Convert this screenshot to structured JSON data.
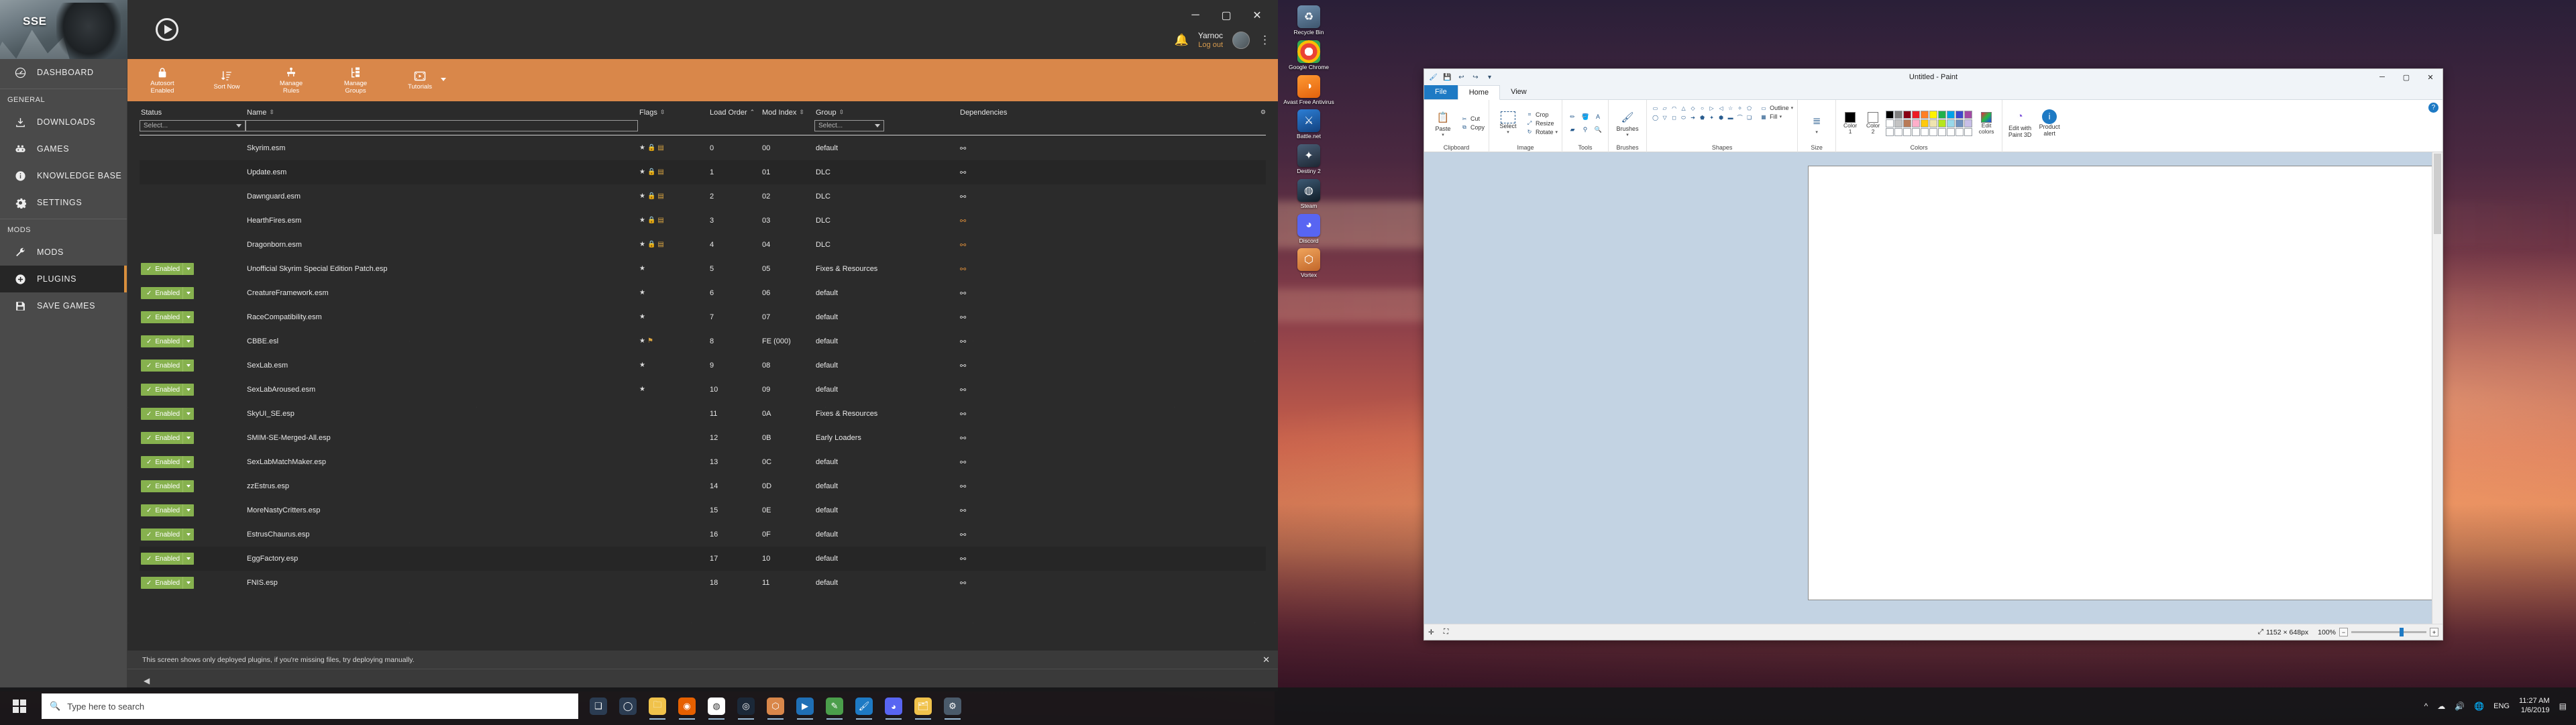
{
  "desktop": {
    "icons": [
      {
        "name": "Recycle Bin",
        "glyph": "♻",
        "color": "#4a6b8a"
      },
      {
        "name": "Google Chrome",
        "glyph": "◉",
        "color": "#ffffff"
      },
      {
        "name": "Avast Free Antivirus",
        "glyph": "◑",
        "color": "#f57c20"
      },
      {
        "name": "Battle.net",
        "glyph": "⚔",
        "color": "#1b5fa8"
      },
      {
        "name": "Destiny 2",
        "glyph": "✦",
        "color": "#2a3c52"
      },
      {
        "name": "Steam",
        "glyph": "◍",
        "color": "#1b2838"
      },
      {
        "name": "Discord",
        "glyph": "◕",
        "color": "#5865f2"
      },
      {
        "name": "Vortex",
        "glyph": "⬡",
        "color": "#d9874a"
      }
    ]
  },
  "vortex": {
    "hero_title": "SSE",
    "play_icon": "play-icon",
    "window_controls": {
      "minimize": "─",
      "maximize": "▢",
      "close": "✕"
    },
    "notification_icon": "bell-icon",
    "user": {
      "name": "Yarnoc",
      "logout": "Log out"
    },
    "kebab": "⋮",
    "sidebar": {
      "top": [
        {
          "label": "DASHBOARD",
          "icon": "speedometer-icon",
          "active": false
        }
      ],
      "groups": [
        {
          "title": "GENERAL",
          "items": [
            {
              "label": "DOWNLOADS",
              "icon": "download-icon",
              "active": false
            },
            {
              "label": "GAMES",
              "icon": "gamepad-icon",
              "active": false
            },
            {
              "label": "KNOWLEDGE BASE",
              "icon": "info-icon",
              "active": false
            },
            {
              "label": "SETTINGS",
              "icon": "gear-icon",
              "active": false
            }
          ]
        },
        {
          "title": "MODS",
          "items": [
            {
              "label": "MODS",
              "icon": "wrench-icon",
              "active": false
            },
            {
              "label": "PLUGINS",
              "icon": "plus-circle-icon",
              "active": true
            },
            {
              "label": "SAVE GAMES",
              "icon": "floppy-disk-icon",
              "active": false
            }
          ]
        }
      ]
    },
    "toolbar": [
      {
        "label": "Autosort\nEnabled",
        "icon": "lock-icon",
        "caret": false
      },
      {
        "label": "Sort Now",
        "icon": "sort-icon",
        "caret": false
      },
      {
        "label": "Manage\nRules",
        "icon": "rules-icon",
        "caret": false
      },
      {
        "label": "Manage\nGroups",
        "icon": "groups-icon",
        "caret": false
      },
      {
        "label": "Tutorials",
        "icon": "video-icon",
        "caret": true
      }
    ],
    "table": {
      "columns": [
        {
          "key": "status",
          "label": "Status",
          "sortable": false,
          "filter": "select",
          "filter_value": "Select..."
        },
        {
          "key": "name",
          "label": "Name",
          "sortable": true,
          "filter": "text",
          "filter_value": ""
        },
        {
          "key": "flags",
          "label": "Flags",
          "sortable": true,
          "filter": "none"
        },
        {
          "key": "load_order",
          "label": "Load Order",
          "sortable": true,
          "filter": "none"
        },
        {
          "key": "mod_index",
          "label": "Mod Index",
          "sortable": true,
          "filter": "none"
        },
        {
          "key": "group",
          "label": "Group",
          "sortable": true,
          "filter": "select",
          "filter_value": "Select..."
        },
        {
          "key": "dependencies",
          "label": "Dependencies",
          "sortable": false,
          "filter": "none"
        }
      ],
      "rows": [
        {
          "status": "",
          "name": "Skyrim.esm",
          "flags": [
            "★",
            "🔒",
            "▤"
          ],
          "load_order": "0",
          "mod_index": "00",
          "group": "default",
          "dep": "normal",
          "alt": false
        },
        {
          "status": "",
          "name": "Update.esm",
          "flags": [
            "★",
            "🔒",
            "▤"
          ],
          "load_order": "1",
          "mod_index": "01",
          "group": "DLC",
          "dep": "normal",
          "alt": true
        },
        {
          "status": "",
          "name": "Dawnguard.esm",
          "flags": [
            "★",
            "🔒",
            "▤"
          ],
          "load_order": "2",
          "mod_index": "02",
          "group": "DLC",
          "dep": "normal",
          "alt": false
        },
        {
          "status": "",
          "name": "HearthFires.esm",
          "flags": [
            "★",
            "🔒",
            "▤"
          ],
          "load_order": "3",
          "mod_index": "03",
          "group": "DLC",
          "dep": "warn",
          "alt": false
        },
        {
          "status": "",
          "name": "Dragonborn.esm",
          "flags": [
            "★",
            "🔒",
            "▤"
          ],
          "load_order": "4",
          "mod_index": "04",
          "group": "DLC",
          "dep": "warn",
          "alt": false
        },
        {
          "status": "Enabled",
          "name": "Unofficial Skyrim Special Edition Patch.esp",
          "flags": [
            "★"
          ],
          "load_order": "5",
          "mod_index": "05",
          "group": "Fixes & Resources",
          "dep": "warn",
          "alt": false
        },
        {
          "status": "Enabled",
          "name": "CreatureFramework.esm",
          "flags": [
            "★"
          ],
          "load_order": "6",
          "mod_index": "06",
          "group": "default",
          "dep": "normal",
          "alt": false
        },
        {
          "status": "Enabled",
          "name": "RaceCompatibility.esm",
          "flags": [
            "★"
          ],
          "load_order": "7",
          "mod_index": "07",
          "group": "default",
          "dep": "normal",
          "alt": false
        },
        {
          "status": "Enabled",
          "name": "CBBE.esl",
          "flags": [
            "★",
            "⚑"
          ],
          "load_order": "8",
          "mod_index": "FE (000)",
          "group": "default",
          "dep": "normal",
          "alt": false
        },
        {
          "status": "Enabled",
          "name": "SexLab.esm",
          "flags": [
            "★"
          ],
          "load_order": "9",
          "mod_index": "08",
          "group": "default",
          "dep": "normal",
          "alt": false
        },
        {
          "status": "Enabled",
          "name": "SexLabAroused.esm",
          "flags": [
            "★"
          ],
          "load_order": "10",
          "mod_index": "09",
          "group": "default",
          "dep": "normal",
          "alt": false
        },
        {
          "status": "Enabled",
          "name": "SkyUI_SE.esp",
          "flags": [],
          "load_order": "11",
          "mod_index": "0A",
          "group": "Fixes & Resources",
          "dep": "normal",
          "alt": false
        },
        {
          "status": "Enabled",
          "name": "SMIM-SE-Merged-All.esp",
          "flags": [],
          "load_order": "12",
          "mod_index": "0B",
          "group": "Early Loaders",
          "dep": "normal",
          "alt": false
        },
        {
          "status": "Enabled",
          "name": "SexLabMatchMaker.esp",
          "flags": [],
          "load_order": "13",
          "mod_index": "0C",
          "group": "default",
          "dep": "normal",
          "alt": false
        },
        {
          "status": "Enabled",
          "name": "zzEstrus.esp",
          "flags": [],
          "load_order": "14",
          "mod_index": "0D",
          "group": "default",
          "dep": "normal",
          "alt": false
        },
        {
          "status": "Enabled",
          "name": "MoreNastyCritters.esp",
          "flags": [],
          "load_order": "15",
          "mod_index": "0E",
          "group": "default",
          "dep": "normal",
          "alt": false
        },
        {
          "status": "Enabled",
          "name": "EstrusChaurus.esp",
          "flags": [],
          "load_order": "16",
          "mod_index": "0F",
          "group": "default",
          "dep": "normal",
          "alt": false
        },
        {
          "status": "Enabled",
          "name": "EggFactory.esp",
          "flags": [],
          "load_order": "17",
          "mod_index": "10",
          "group": "default",
          "dep": "normal",
          "alt": true
        },
        {
          "status": "Enabled",
          "name": "FNIS.esp",
          "flags": [],
          "load_order": "18",
          "mod_index": "11",
          "group": "default",
          "dep": "normal",
          "alt": false
        }
      ]
    },
    "status_message": "This screen shows only deployed plugins, if you're missing files, try deploying manually.",
    "status_close": "✕"
  },
  "paint": {
    "title": "Untitled - Paint",
    "qat_icons": [
      "paint-app-icon",
      "save-icon",
      "undo-icon",
      "redo-icon",
      "customize-caret-icon"
    ],
    "window_controls": {
      "minimize": "─",
      "maximize": "▢",
      "close": "✕"
    },
    "help_icon": "help-icon",
    "tabs": [
      {
        "label": "File",
        "kind": "file"
      },
      {
        "label": "Home",
        "kind": "active"
      },
      {
        "label": "View",
        "kind": "normal"
      }
    ],
    "ribbon": {
      "clipboard": {
        "label": "Clipboard",
        "paste": "Paste",
        "items": [
          {
            "label": "Cut",
            "icon": "scissors-icon"
          },
          {
            "label": "Copy",
            "icon": "copy-icon"
          }
        ]
      },
      "image": {
        "label": "Image",
        "select": "Select",
        "items": [
          {
            "label": "Crop",
            "icon": "crop-icon"
          },
          {
            "label": "Resize",
            "icon": "resize-icon"
          },
          {
            "label": "Rotate",
            "icon": "rotate-icon"
          }
        ]
      },
      "tools": {
        "label": "Tools",
        "icons": [
          "pencil-icon",
          "fill-icon",
          "text-icon",
          "eraser-icon",
          "color-picker-icon",
          "magnifier-icon"
        ]
      },
      "brushes": {
        "label": "Brushes",
        "caption": "Brushes",
        "icon": "brush-icon"
      },
      "shapes": {
        "label": "Shapes",
        "outline": "Outline",
        "fill": "Fill",
        "glyphs": [
          "▭",
          "▱",
          "◠",
          "△",
          "◇",
          "○",
          "▷",
          "◁",
          "☆",
          "✧",
          "⬠",
          "◯",
          "▽",
          "◻",
          "⬭",
          "➔",
          "⬟",
          "✦",
          "⬢",
          "▬",
          "⌒",
          "❏"
        ]
      },
      "size": {
        "label": "Size",
        "icon": "size-icon"
      },
      "colors": {
        "label": "Colors",
        "color1": "Color\n1",
        "color2": "Color\n2",
        "edit_colors": "Edit\ncolors",
        "color1_value": "#000000",
        "color2_value": "#ffffff",
        "swatches": [
          "#000000",
          "#7f7f7f",
          "#880015",
          "#ed1c24",
          "#ff7f27",
          "#fff200",
          "#22b14c",
          "#00a2e8",
          "#3f48cc",
          "#a349a4",
          "#ffffff",
          "#c3c3c3",
          "#b97a57",
          "#ffaec9",
          "#ffc90e",
          "#efe4b0",
          "#b5e61d",
          "#99d9ea",
          "#7092be",
          "#c8bfe7",
          "#ffffff",
          "#ffffff",
          "#ffffff",
          "#ffffff",
          "#ffffff",
          "#ffffff",
          "#ffffff",
          "#ffffff",
          "#ffffff",
          "#ffffff"
        ]
      },
      "paint3d": {
        "edit_label": "Edit with\nPaint 3D",
        "product_label": "Product\nalert"
      }
    },
    "status": {
      "cursor_icon": "cursor-icon",
      "selection_icon": "selection-icon",
      "size_icon": "size-icon",
      "dimensions": "1152 × 648px",
      "zoom": "100%",
      "zoom_out": "−",
      "zoom_in": "+"
    },
    "canvas": {
      "width": "1152",
      "height": "648"
    }
  },
  "taskbar": {
    "start_icon": "windows-logo-icon",
    "search_placeholder": "Type here to search",
    "search_icon": "search-icon",
    "apps": [
      {
        "name": "task-view",
        "glyph": "❑",
        "color": "#2b3c52"
      },
      {
        "name": "cortana",
        "glyph": "◯",
        "color": "#2b3c52"
      },
      {
        "name": "file-explorer",
        "glyph": "🗀",
        "color": "#f0c24b"
      },
      {
        "name": "firefox",
        "glyph": "◉",
        "color": "#e66000"
      },
      {
        "name": "chrome",
        "glyph": "◍",
        "color": "#ffffff"
      },
      {
        "name": "steam",
        "glyph": "◎",
        "color": "#1b2838"
      },
      {
        "name": "vortex",
        "glyph": "⬡",
        "color": "#d9874a"
      },
      {
        "name": "media-player",
        "glyph": "▶",
        "color": "#1f6fb5"
      },
      {
        "name": "text-editor",
        "glyph": "✎",
        "color": "#4b9e4b"
      },
      {
        "name": "paint",
        "glyph": "🖌",
        "color": "#1e7ac4"
      },
      {
        "name": "discord",
        "glyph": "◕",
        "color": "#5865f2"
      },
      {
        "name": "folder2",
        "glyph": "🗂",
        "color": "#f0c24b"
      },
      {
        "name": "settings-app",
        "glyph": "⚙",
        "color": "#4a5a6a"
      }
    ],
    "tray": [
      "^",
      "☁",
      "🔊",
      "🌐"
    ],
    "language": "ENG",
    "clock_time": "11:27 AM",
    "clock_date": "1/6/2019",
    "vortex_clock_time": "11:27 AM",
    "vortex_clock_date": "1/6/2019"
  }
}
